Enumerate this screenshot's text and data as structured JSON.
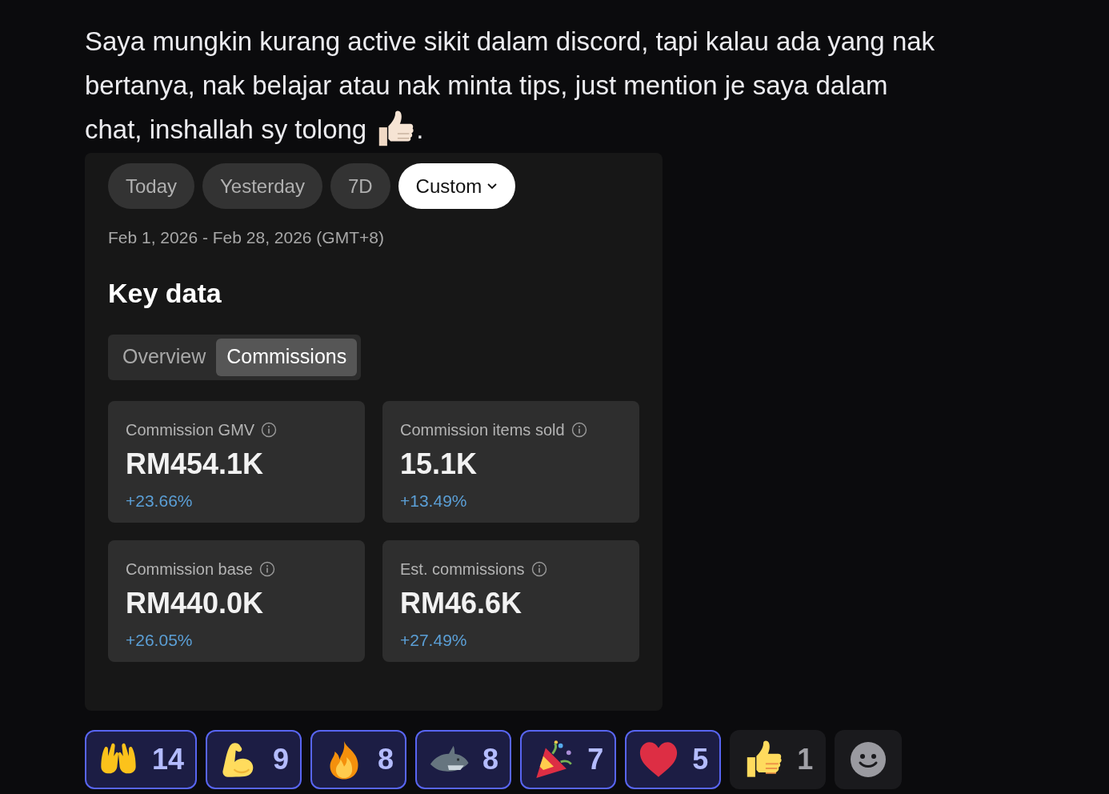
{
  "message": {
    "lines": [
      "Saya mungkin kurang active sikit dalam discord, tapi kalau ada yang nak",
      "bertanya, nak belajar atau nak minta tips, just mention je saya dalam",
      "chat, inshallah sy tolong"
    ],
    "end": "."
  },
  "embed": {
    "range_chips": [
      {
        "label": "Today",
        "selected": false
      },
      {
        "label": "Yesterday",
        "selected": false
      },
      {
        "label": "7D",
        "selected": false
      },
      {
        "label": "Custom",
        "selected": true
      }
    ],
    "date_range": "Feb 1, 2026 - Feb 28, 2026 (GMT+8)",
    "heading": "Key data",
    "tabs": [
      {
        "label": "Overview",
        "selected": false
      },
      {
        "label": "Commissions",
        "selected": true
      }
    ],
    "cards": [
      {
        "label": "Commission GMV",
        "value": "RM454.1K",
        "change": "+23.66%"
      },
      {
        "label": "Commission items sold",
        "value": "15.1K",
        "change": "+13.49%"
      },
      {
        "label": "Commission base",
        "value": "RM440.0K",
        "change": "+26.05%"
      },
      {
        "label": "Est. commissions",
        "value": "RM46.6K",
        "change": "+27.49%"
      }
    ]
  },
  "reactions": [
    {
      "kind": "hands",
      "count": "14",
      "selected": true
    },
    {
      "kind": "muscle",
      "count": "9",
      "selected": true
    },
    {
      "kind": "fire",
      "count": "8",
      "selected": true
    },
    {
      "kind": "shark",
      "count": "8",
      "selected": true
    },
    {
      "kind": "party",
      "count": "7",
      "selected": true
    },
    {
      "kind": "heart",
      "count": "5",
      "selected": true
    },
    {
      "kind": "thumbs",
      "count": "1",
      "selected": false
    }
  ]
}
